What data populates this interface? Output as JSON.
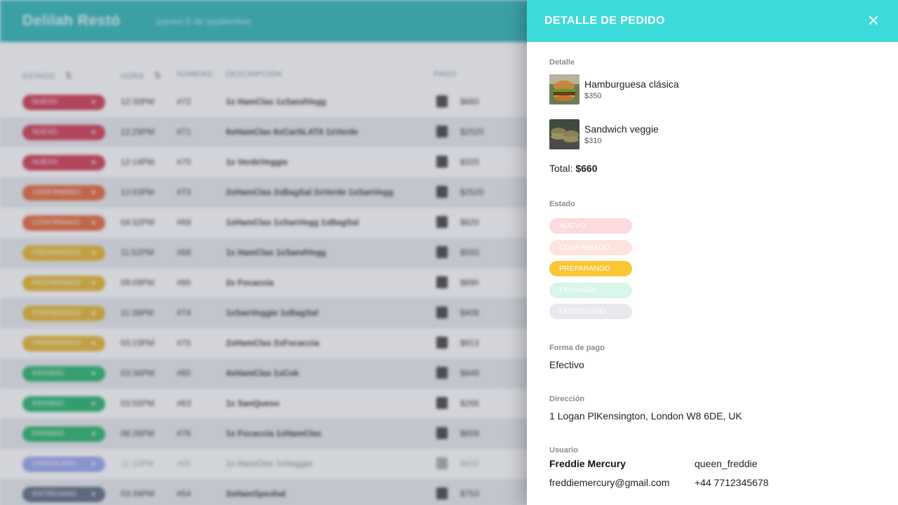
{
  "app": {
    "brand": "Delilah Restó",
    "date": "jueves 5 de septiembre",
    "columns": {
      "estado": "Estado",
      "hora": "Hora",
      "numero": "Número",
      "descripcion": "Descripción",
      "pago": "Pago"
    },
    "rows": [
      {
        "estado": "Nuevo",
        "color": "#d23a52",
        "hora": "12:30PM",
        "numero": "#72",
        "descripcion": "1x HamClas 1xSandVegg",
        "monto": "$660"
      },
      {
        "estado": "Nuevo",
        "color": "#d23a52",
        "hora": "12:29PM",
        "numero": "#71",
        "descripcion": "6xHamClas 6xCarSLATA 1xVerde",
        "monto": "$2520"
      },
      {
        "estado": "Nuevo",
        "color": "#d23a52",
        "hora": "12:14PM",
        "numero": "#70",
        "descripcion": "1x VerdeVeggie",
        "monto": "$320"
      },
      {
        "estado": "Confirmado",
        "color": "#e6673a",
        "hora": "12:03PM",
        "numero": "#73",
        "descripcion": "2xHamClas 2xBagSal 2xVerde 1xSanVegg",
        "monto": "$2520"
      },
      {
        "estado": "Confirmado",
        "color": "#e6673a",
        "hora": "04:32PM",
        "numero": "#69",
        "descripcion": "1xHamClas 1xSanVegg 1xBagSal",
        "monto": "$820"
      },
      {
        "estado": "Preparando",
        "color": "#e8b72e",
        "hora": "11:52PM",
        "numero": "#68",
        "descripcion": "1x HamClas 1xSandVegg",
        "monto": "$593"
      },
      {
        "estado": "Preparando",
        "color": "#e8b72e",
        "hora": "09:09PM",
        "numero": "#66",
        "descripcion": "2x Focaccia",
        "monto": "$690"
      },
      {
        "estado": "Preparando",
        "color": "#e8b72e",
        "hora": "11:38PM",
        "numero": "#74",
        "descripcion": "1xSanVeggie 1xBagSal",
        "monto": "$408"
      },
      {
        "estado": "Preparando",
        "color": "#e8b72e",
        "hora": "03:23PM",
        "numero": "#75",
        "descripcion": "2xHamClas 2xFocaccia",
        "monto": "$913"
      },
      {
        "estado": "Enviado",
        "color": "#27b46b",
        "hora": "03:36PM",
        "numero": "#65",
        "descripcion": "4xHamClas 1xCok",
        "monto": "$849"
      },
      {
        "estado": "Enviado",
        "color": "#27b46b",
        "hora": "03:55PM",
        "numero": "#63",
        "descripcion": "1x SanQueso",
        "monto": "$268"
      },
      {
        "estado": "Enviado",
        "color": "#27b46b",
        "hora": "08:26PM",
        "numero": "#76",
        "descripcion": "1x Focaccia 1xHamClas",
        "monto": "$659"
      },
      {
        "estado": "Cancelado",
        "color": "#9aa6ef",
        "hora": "11:10PM",
        "numero": "#65",
        "descripcion": "1x HamClas 1xVeggie",
        "monto": "$432",
        "faded": true
      },
      {
        "estado": "Entregado",
        "color": "#5d6c80",
        "hora": "03:39PM",
        "numero": "#54",
        "descripcion": "3xHamSpeshal",
        "monto": "$753"
      }
    ]
  },
  "panel": {
    "title": "DETALLE DE PEDIDO",
    "detalle_label": "Detalle",
    "items": [
      {
        "name": "Hamburguesa clásica",
        "price": "$350"
      },
      {
        "name": "Sandwich veggie",
        "price": "$310"
      }
    ],
    "total_label": "Total:",
    "total_value": "$660",
    "estado_label": "Estado",
    "estados": [
      {
        "label": "NUEVO",
        "color": "#fcdade"
      },
      {
        "label": "CONFIRMADO",
        "color": "#fde3dc"
      },
      {
        "label": "PREPARANDO",
        "color": "#fcc533",
        "selected": true
      },
      {
        "label": "ENVIANDO",
        "color": "#d7f5e8"
      },
      {
        "label": "ENTREGADO",
        "color": "#e6e8ec"
      }
    ],
    "pago_label": "Forma de pago",
    "pago_value": "Efectivo",
    "direccion_label": "Dirección",
    "direccion_value": "1 Logan PlKensington, London W8 6DE, UK",
    "usuario_label": "Usuario",
    "usuario": {
      "name": "Freddie Mercury",
      "handle": "queen_freddie",
      "email": "freddiemercury@gmail.com",
      "phone": "+44 7712345678"
    }
  }
}
